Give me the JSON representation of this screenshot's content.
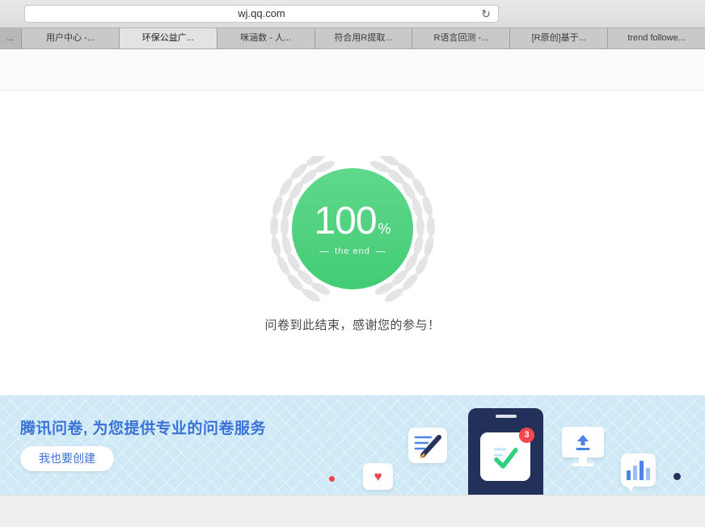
{
  "browser": {
    "url": "wj.qq.com",
    "tabs": [
      {
        "label": "...",
        "active": false
      },
      {
        "label": "用户中心 -...",
        "active": false
      },
      {
        "label": "环保公益广...",
        "active": true
      },
      {
        "label": "咪涵数 - 人...",
        "active": false
      },
      {
        "label": "符合用R提取...",
        "active": false
      },
      {
        "label": "R语言回测 -...",
        "active": false
      },
      {
        "label": "[R原创]基于...",
        "active": false
      },
      {
        "label": "trend followe...",
        "active": false
      }
    ]
  },
  "survey": {
    "percent": "100",
    "percent_sign": "%",
    "end_caption": "the end",
    "end_message": "问卷到此结束，感谢您的参与！"
  },
  "banner": {
    "headline": "腾讯问卷, 为您提供专业的问卷服务",
    "create_button_label": "我也要创建",
    "notification_count": "3"
  },
  "icons": {
    "reload": "↻",
    "heart": "♥"
  },
  "colors": {
    "badge_green": "#4fd07e",
    "headline_blue": "#3b72d8",
    "banner_bg": "#cfeaf6",
    "notification_red": "#f5484d",
    "phone_navy": "#22305a",
    "wreath_gray": "#e4e4e4"
  }
}
